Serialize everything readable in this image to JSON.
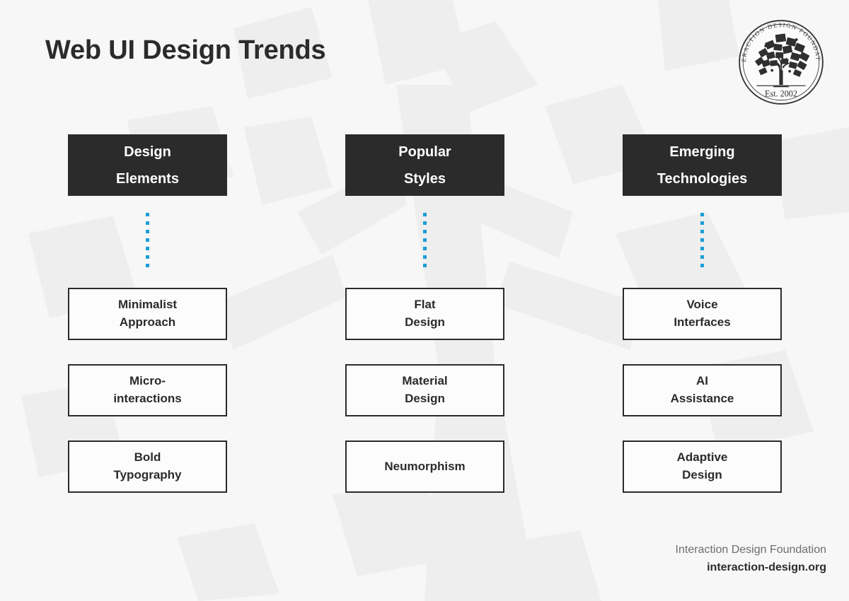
{
  "slide": {
    "title": "Web UI Design Trends",
    "background_color": "#f7f7f7",
    "accent_color": "#1a9ed6",
    "header_color": "#2b2b2b"
  },
  "logo": {
    "name": "interaction-design-foundation-seal",
    "ring_text": "INTERACTION DESIGN FOUNDATION",
    "established": "Est. 2002"
  },
  "columns": [
    {
      "header_line1": "Design",
      "header_line2": "Elements",
      "items": [
        {
          "line1": "Minimalist",
          "line2": "Approach"
        },
        {
          "line1": "Micro-",
          "line2": "interactions"
        },
        {
          "line1": "Bold",
          "line2": "Typography"
        }
      ]
    },
    {
      "header_line1": "Popular",
      "header_line2": "Styles",
      "items": [
        {
          "line1": "Flat",
          "line2": "Design"
        },
        {
          "line1": "Material",
          "line2": "Design"
        },
        {
          "line1": "Neumorphism",
          "line2": ""
        }
      ]
    },
    {
      "header_line1": "Emerging",
      "header_line2": "Technologies",
      "items": [
        {
          "line1": "Voice",
          "line2": "Interfaces"
        },
        {
          "line1": "AI",
          "line2": "Assistance"
        },
        {
          "line1": "Adaptive",
          "line2": "Design"
        }
      ]
    }
  ],
  "footer": {
    "organization": "Interaction Design Foundation",
    "website": "interaction-design.org"
  }
}
